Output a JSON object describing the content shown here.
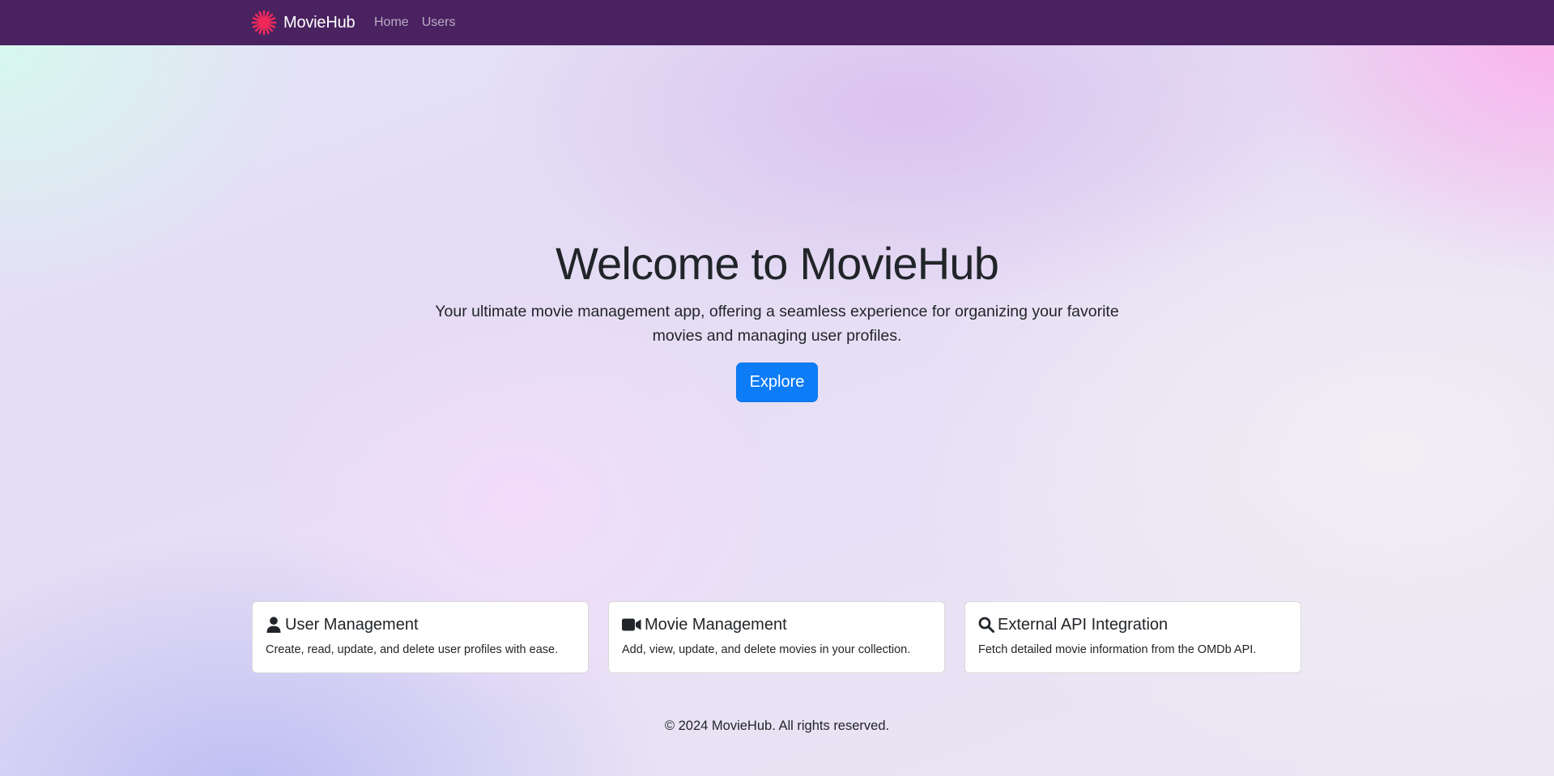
{
  "navbar": {
    "brand": "MovieHub",
    "brand_icon": "red-asterisk-logo-icon",
    "links": [
      {
        "label": "Home"
      },
      {
        "label": "Users"
      }
    ],
    "background": "#4a2260"
  },
  "hero": {
    "title": "Welcome to MovieHub",
    "subtitle": "Your ultimate movie management app, offering a seamless experience for organizing your favorite movies and managing user profiles.",
    "button_label": "Explore",
    "button_color": "#0d7cf7"
  },
  "features": [
    {
      "icon": "user-icon",
      "title": "User Management",
      "description": "Create, read, update, and delete user profiles with ease."
    },
    {
      "icon": "video-camera-icon",
      "title": "Movie Management",
      "description": "Add, view, update, and delete movies in your collection."
    },
    {
      "icon": "search-icon",
      "title": "External API Integration",
      "description": "Fetch detailed movie information from the OMDb API."
    }
  ],
  "footer": {
    "text": "© 2024 MovieHub. All rights reserved."
  },
  "colors": {
    "logo_accent": "#f0285a"
  }
}
